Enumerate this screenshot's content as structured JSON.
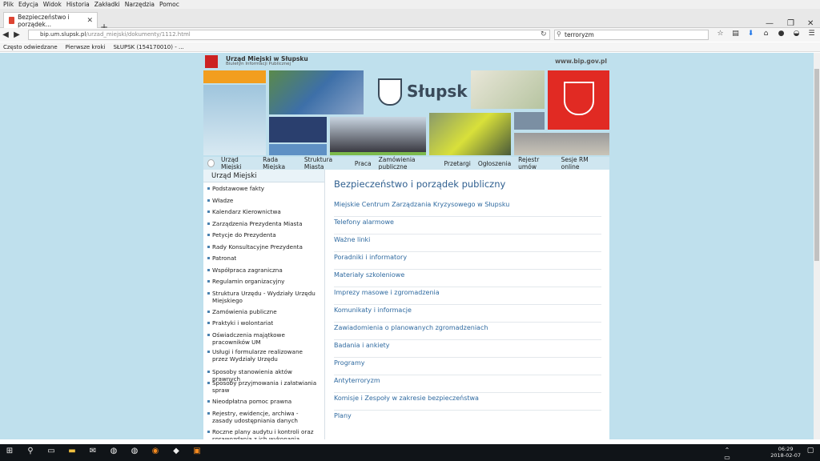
{
  "menubar": [
    "Plik",
    "Edycja",
    "Widok",
    "Historia",
    "Zakładki",
    "Narzędzia",
    "Pomoc"
  ],
  "tab": {
    "title": "Bezpieczeństwo i porządek..."
  },
  "address": {
    "host": "bip.um.slupsk.pl",
    "path": "/urzad_miejski/dokumenty/1112.html"
  },
  "search": {
    "value": "terroryzm"
  },
  "bookmarks": [
    "Często odwiedzane",
    "Pierwsze kroki",
    "SŁUPSK (154170010) - ..."
  ],
  "header": {
    "org_name": "Urząd Miejski w Słupsku",
    "org_sub": "Biuletyn Informacji Publicznej",
    "bip_url": "www.bip.gov.pl",
    "city": "Słupsk"
  },
  "topnav": [
    "Urząd Miejski",
    "Rada Miejska",
    "Struktura Miasta",
    "Praca",
    "Zamówienia publiczne",
    "Przetargi",
    "Ogłoszenia",
    "Rejestr umów",
    "Sesje RM online"
  ],
  "sidebar": {
    "heading": "Urząd Miejski",
    "items": [
      "Podstawowe fakty",
      "Władze",
      "Kalendarz Kierownictwa",
      "Zarządzenia Prezydenta Miasta",
      "Petycje do Prezydenta",
      "Rady Konsultacyjne Prezydenta",
      "Patronat",
      "Współpraca zagraniczna",
      "Regulamin organizacyjny",
      "Struktura Urzędu - Wydziały Urzędu Miejskiego",
      "Zamówienia publiczne",
      "Praktyki i wolontariat",
      "Oświadczenia majątkowe pracowników UM",
      "Usługi i formularze realizowane przez Wydziały Urzędu",
      "Sposoby stanowienia aktów prawnych",
      "Sposoby przyjmowania i załatwiania spraw",
      "Nieodpłatna pomoc prawna",
      "Rejestry, ewidencje, archiwa - zasady udostępniania danych",
      "Roczne plany audytu i kontroli oraz sprawozdania z ich wykonania"
    ]
  },
  "main": {
    "title": "Bezpieczeństwo i porządek publiczny",
    "links": [
      "Miejskie Centrum Zarządzania Kryzysowego w Słupsku",
      "Telefony alarmowe",
      "Ważne linki",
      "Poradniki i informatory",
      "Materiały szkoleniowe",
      "Imprezy masowe i zgromadzenia",
      "Komunikaty i informacje",
      "Zawiadomienia o planowanych zgromadzeniach",
      "Badania i ankiety",
      "Programy",
      "Antyterroryzm",
      "Komisje i Zespoły w zakresie bezpieczeństwa",
      "Plany"
    ]
  },
  "clock": {
    "time": "06:29",
    "date": "2018-02-07"
  }
}
